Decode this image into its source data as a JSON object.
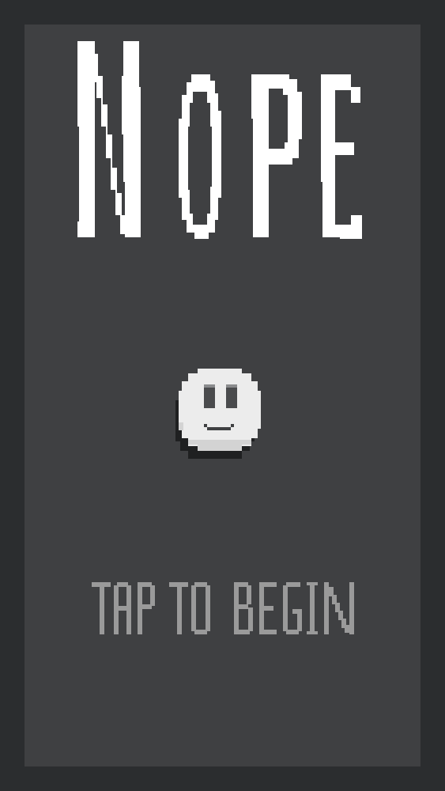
{
  "game": {
    "title": "Nope",
    "prompt": "TAP TO BEGIN"
  },
  "player": {
    "icon": "smiley-ball-icon"
  },
  "colors": {
    "border": "#2b2d2f",
    "background": "#3f4042",
    "title": "#ffffff",
    "prompt": "#9a9a9a",
    "ball": "#ececec",
    "ball_shadow": "#1f2021",
    "ball_eyes": "#4a4b4d"
  }
}
